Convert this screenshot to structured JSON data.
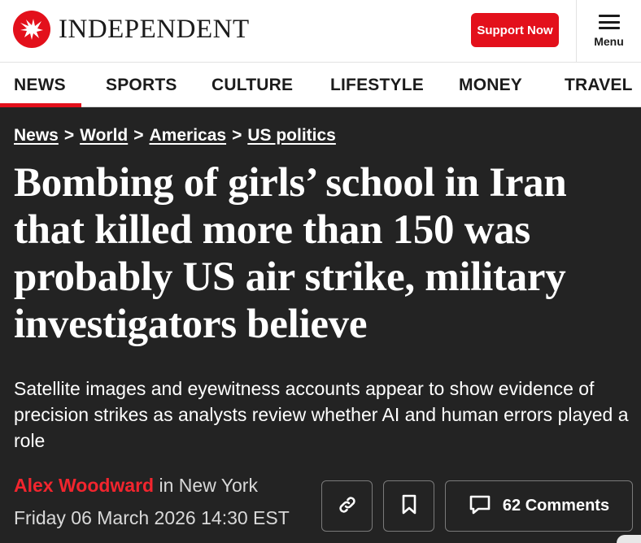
{
  "header": {
    "logo_text": "INDEPENDENT",
    "support_label": "Support Now",
    "menu_label": "Menu"
  },
  "nav": {
    "items": [
      "NEWS",
      "SPORTS",
      "CULTURE",
      "LIFESTYLE",
      "MONEY",
      "TRAVEL"
    ],
    "active": "NEWS"
  },
  "breadcrumb": {
    "items": [
      "News",
      "World",
      "Americas",
      "US politics"
    ],
    "separator": ">"
  },
  "article": {
    "headline": "Bombing of girls’ school in Iran that killed more than 150 was probably US air strike, military investigators believe",
    "standfirst": "Satellite images and eyewitness accounts appear to show evidence of precision strikes as analysts review whether AI and human errors played a role",
    "author": "Alex Woodward",
    "location": " in New York",
    "date": "Friday 06 March 2026 14:30 EST",
    "comments_label": "62 Comments"
  },
  "colors": {
    "brand_red": "#e3101b",
    "background": "#232323",
    "author_red": "#f2252e"
  },
  "icons": {
    "logo": "eagle-icon",
    "menu": "hamburger-menu-icon",
    "share": "link-icon",
    "bookmark": "bookmark-icon",
    "comments": "comment-icon"
  }
}
